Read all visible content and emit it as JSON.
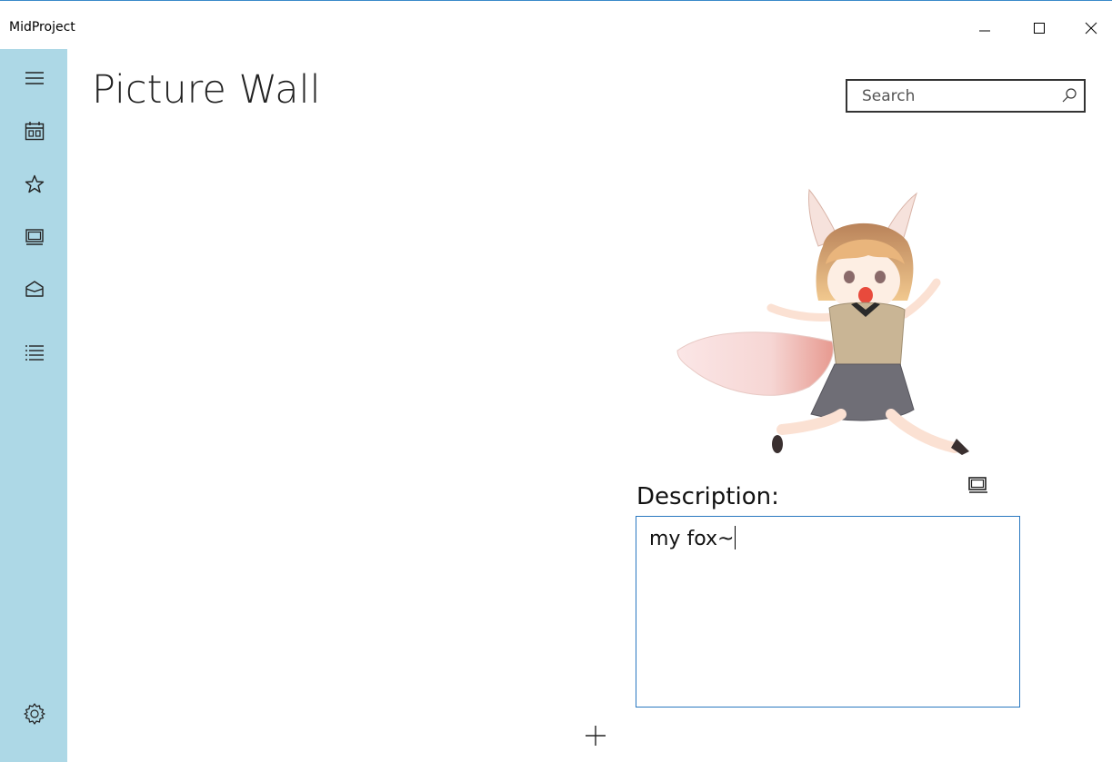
{
  "window": {
    "title": "MidProject",
    "accent_color": "#3a8ac9"
  },
  "sidebar": {
    "background": "#add8e6",
    "items": [
      {
        "icon": "hamburger-menu-icon"
      },
      {
        "icon": "calendar-icon"
      },
      {
        "icon": "star-icon"
      },
      {
        "icon": "slideshow-icon"
      },
      {
        "icon": "mail-open-icon"
      },
      {
        "icon": "list-icon"
      }
    ],
    "footer_icon": "settings-icon"
  },
  "page": {
    "title": "Picture Wall"
  },
  "search": {
    "placeholder": "Search",
    "icon": "search-icon"
  },
  "picture": {
    "subject": "fox-girl-illustration"
  },
  "description": {
    "label": "Description:",
    "value": "my fox~",
    "border_color": "#2a78c0"
  },
  "actions": {
    "add_icon": "plus-icon"
  }
}
